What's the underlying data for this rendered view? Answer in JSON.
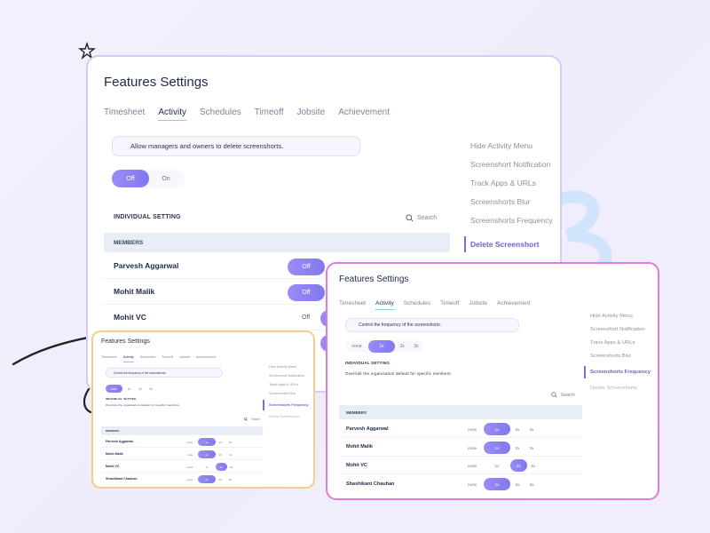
{
  "title": "Features Settings",
  "tabs": [
    "Timesheet",
    "Activity",
    "Schedules",
    "Timeoff",
    "Jobsite",
    "Achievement"
  ],
  "active_tab": "Activity",
  "main": {
    "banner_text": "Allow managers and owners to delete screenshorts.",
    "toggle": {
      "options": [
        "Off",
        "On"
      ],
      "selected": "Off"
    },
    "individual_setting_label": "INDIVIDUAL SETTING",
    "search_label": "Search",
    "members_header": "MEMBERS",
    "members": [
      {
        "name": "Parvesh Aggarwal",
        "value": "Off"
      },
      {
        "name": "Mohit Malik",
        "value": "Off"
      },
      {
        "name": "Mohit VC",
        "value": "Off"
      }
    ],
    "sidenav": [
      "Hide Activity Menu",
      "Screenshort Notification",
      "Track Apps & URLs",
      "Screenshorts Blur",
      "Screenshorts Frequency",
      "Delete Screenshort"
    ],
    "sidenav_active": "Delete Screenshort"
  },
  "frequency_panel": {
    "title": "Features Settings",
    "banner_text": "Control the frequency of the screenshorts.",
    "options": [
      "none",
      "1x",
      "2x",
      "3x"
    ],
    "selected": "1x",
    "individual_setting_label": "INDIVIDUAL SETTING",
    "individual_setting_desc": "Override the organisation default for specific members",
    "search_label": "Search",
    "members_header": "MEMBERS",
    "members": [
      {
        "name": "Parvesh Aggarwal",
        "value": "1x"
      },
      {
        "name": "Mohit Malik",
        "value": "1x"
      },
      {
        "name": "Mohit VC",
        "value": "2x"
      },
      {
        "name": "Shashikant Chauhan",
        "value": "1x"
      }
    ],
    "sidenav": [
      "Hide Activity Menu",
      "Screenshort Notification",
      "Track Apps & URLs",
      "Screenshorts Blur",
      "Screenshorts Frequency",
      "Delete Screenshorts"
    ],
    "sidenav_active": "Screenshorts Frequency"
  },
  "small_panel": {
    "title": "Features Settings",
    "banner_text": "Control the frequency of the screenshorts.",
    "options": [
      "none",
      "1x",
      "2x",
      "3x"
    ],
    "selected": "none",
    "individual_setting_label": "INDIVIDUAL SETTING",
    "individual_setting_desc": "Override the organisation default for specific members",
    "search_label": "Search",
    "members_header": "MEMBERS",
    "members": [
      {
        "name": "Parvesh Aggarwal",
        "value": "1x"
      },
      {
        "name": "Mohit Malik",
        "value": "1x"
      },
      {
        "name": "Mohit VC",
        "value": "2x"
      },
      {
        "name": "Shashikant Chauhan",
        "value": "1x"
      }
    ],
    "sidenav": [
      "Hide Activity Menu",
      "Screenshort Notification",
      "Track Apps & URLs",
      "Screenshorts Blur",
      "Screenshorts Frequency",
      "Delete Screenshorts"
    ],
    "sidenav_active": "Screenshorts Frequency"
  },
  "colors": {
    "accent": "#8277f0",
    "accent_light": "#9a8cf6",
    "active_text": "#6c5fd6",
    "tab_underline": "#7dd3da",
    "panel2_border": "#e27bd9",
    "panel3_border": "#f5cf87",
    "panel1_border": "#d4ccf7"
  }
}
